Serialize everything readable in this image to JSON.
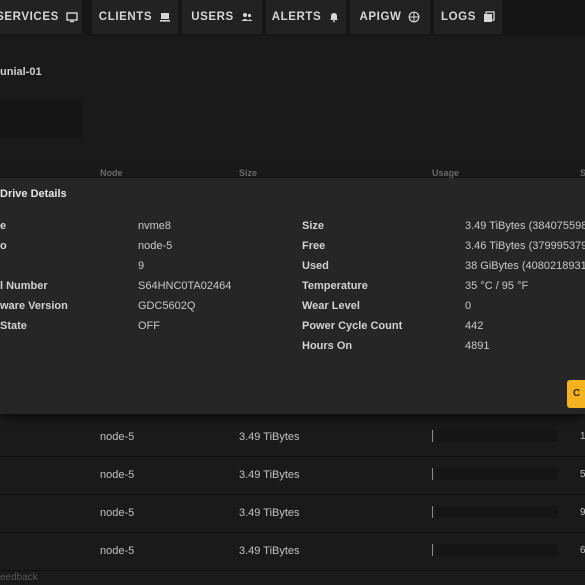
{
  "nav": {
    "tabs": [
      {
        "label": "SERVICES",
        "icon": "monitor-icon"
      },
      {
        "label": "CLIENTS",
        "icon": "laptop-icon"
      },
      {
        "label": "USERS",
        "icon": "users-icon"
      },
      {
        "label": "ALERTS",
        "icon": "bell-icon"
      },
      {
        "label": "APIGW",
        "icon": "globe-icon"
      },
      {
        "label": "LOGS",
        "icon": "logs-icon"
      }
    ]
  },
  "cluster": {
    "title": "unial-01"
  },
  "table": {
    "headers": [
      "Node",
      "Size",
      "Usage",
      "S"
    ],
    "rows": [
      {
        "node": "node-5",
        "size": "3.49 TiBytes",
        "edge": "1"
      },
      {
        "node": "node-5",
        "size": "3.49 TiBytes",
        "edge": "5"
      },
      {
        "node": "node-5",
        "size": "3.49 TiBytes",
        "edge": "9"
      },
      {
        "node": "node-5",
        "size": "3.49 TiBytes",
        "edge": "6"
      }
    ]
  },
  "modal": {
    "title": "Drive Details",
    "left": [
      {
        "label": "e",
        "value": "nvme8"
      },
      {
        "label": "o",
        "value": "node-5"
      },
      {
        "label": "",
        "value": "9"
      },
      {
        "label": "l Number",
        "value": "S64HNC0TA02464"
      },
      {
        "label": "ware Version",
        "value": "GDC5602Q"
      },
      {
        "label": "State",
        "value": "OFF"
      }
    ],
    "right": [
      {
        "label": "Size",
        "value": "3.49 TiBytes (3840755982"
      },
      {
        "label": "Free",
        "value": "3.46 TiBytes (3799953792"
      },
      {
        "label": "Used",
        "value": "38 GiBytes (40802189312"
      },
      {
        "label": "Temperature",
        "value": "35 °C / 95 °F"
      },
      {
        "label": "Wear Level",
        "value": "0"
      },
      {
        "label": "Power Cycle Count",
        "value": "442"
      },
      {
        "label": "Hours On",
        "value": "4891"
      }
    ],
    "close_label": "C"
  },
  "footer": {
    "feedback": "eedback"
  },
  "colors": {
    "accent": "#f5b21f",
    "background": "#1b1b1b",
    "modal": "#262626"
  }
}
